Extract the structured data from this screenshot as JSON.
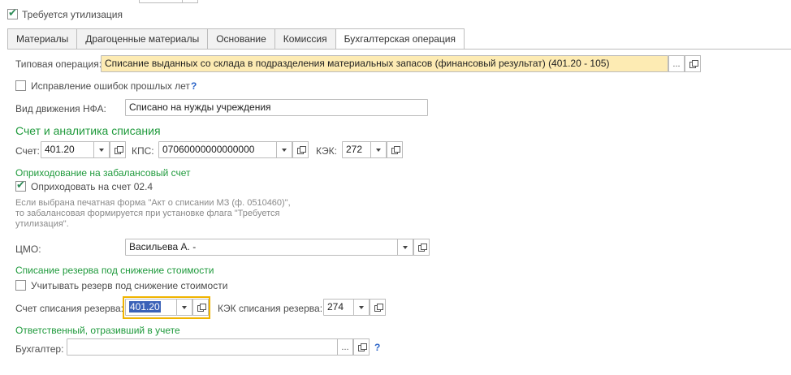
{
  "header": {
    "disposal_required": {
      "label": "Требуется утилизация",
      "checked": true
    }
  },
  "tabs": [
    {
      "label": "Материалы",
      "active": false
    },
    {
      "label": "Драгоценные материалы",
      "active": false
    },
    {
      "label": "Основание",
      "active": false
    },
    {
      "label": "Комиссия",
      "active": false
    },
    {
      "label": "Бухгалтерская операция",
      "active": true
    }
  ],
  "operation": {
    "label": "Типовая операция:",
    "value": "Списание выданных со склада в подразделения материальных запасов (финансовый результат) (401.20 - 105)",
    "highlight_color": "#fdebb3"
  },
  "corrections": {
    "label": "Исправление ошибок прошлых лет",
    "checked": false,
    "help": "?"
  },
  "nfa_movement": {
    "label": "Вид движения НФА:",
    "value": "Списано на нужды учреждения"
  },
  "account_section": {
    "title": "Счет и аналитика списания",
    "account": {
      "label": "Счет:",
      "value": "401.20"
    },
    "kps": {
      "label": "КПС:",
      "value": "07060000000000000"
    },
    "kek": {
      "label": "КЭК:",
      "value": "272"
    }
  },
  "offbalance": {
    "title": "Оприходование на забалансовый счет",
    "checkbox": {
      "label": "Оприходовать на счет 02.4",
      "checked": true
    },
    "note_lines": [
      "Если выбрана печатная форма \"Акт о списании МЗ (ф. 0510460)\",",
      "то забалансовая формируется при установке флага \"Требуется",
      "утилизация\"."
    ]
  },
  "cmo": {
    "label": "ЦМО:",
    "value": "Васильева А. -"
  },
  "reserve": {
    "title": "Списание резерва под снижение стоимости",
    "checkbox": {
      "label": "Учитывать резерв под снижение стоимости",
      "checked": false
    },
    "account": {
      "label": "Счет списания резерва:",
      "value": "401.20"
    },
    "kek": {
      "label": "КЭК списания резерва:",
      "value": "274"
    }
  },
  "responsible": {
    "title": "Ответственный, отразивший в учете",
    "accountant": {
      "label": "Бухгалтер:",
      "value": "",
      "help": "?"
    }
  },
  "colors": {
    "section_green": "#1f9a3c",
    "focus_border": "#f0b400",
    "selection": "#3b62b8"
  }
}
